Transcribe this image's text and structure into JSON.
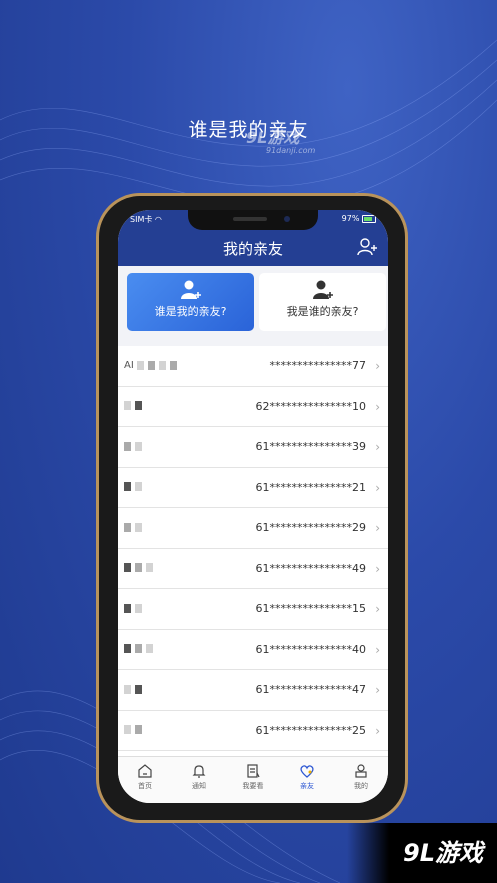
{
  "headline": "谁是我的亲友",
  "watermark_small": {
    "brand": "9L游戏",
    "site": "91danji.com"
  },
  "watermark_big": "9L游戏",
  "status_bar": {
    "carrier": "SIM卡",
    "battery": "97%"
  },
  "nav": {
    "title": "我的亲友",
    "add_icon": "add-user-icon"
  },
  "cards": [
    {
      "label": "谁是我的亲友?",
      "active": true,
      "icon": "add-user-icon"
    },
    {
      "label": "我是谁的亲友?",
      "active": false,
      "icon": "add-user-icon"
    }
  ],
  "rows": [
    {
      "name_prefix": "AI",
      "phone": "***************77"
    },
    {
      "name_prefix": "",
      "phone": "62***************10"
    },
    {
      "name_prefix": "",
      "phone": "61***************39"
    },
    {
      "name_prefix": "",
      "phone": "61***************21"
    },
    {
      "name_prefix": "",
      "phone": "61***************29"
    },
    {
      "name_prefix": "",
      "phone": "61***************49"
    },
    {
      "name_prefix": "",
      "phone": "61***************15"
    },
    {
      "name_prefix": "",
      "phone": "61***************40"
    },
    {
      "name_prefix": "",
      "phone": "61***************47"
    },
    {
      "name_prefix": "",
      "phone": "61***************25"
    }
  ],
  "tabs": [
    {
      "label": "首页",
      "icon": "home-icon",
      "active": false
    },
    {
      "label": "通知",
      "icon": "bell-icon",
      "active": false
    },
    {
      "label": "我要看",
      "icon": "document-icon",
      "active": false
    },
    {
      "label": "亲友",
      "icon": "heart-icon",
      "active": true
    },
    {
      "label": "我的",
      "icon": "user-icon",
      "active": false
    }
  ],
  "colors": {
    "accent": "#2e58d3",
    "nav_bg": "#243f93",
    "page_bg": "#2b4aa9",
    "frame": "#b9935b"
  }
}
